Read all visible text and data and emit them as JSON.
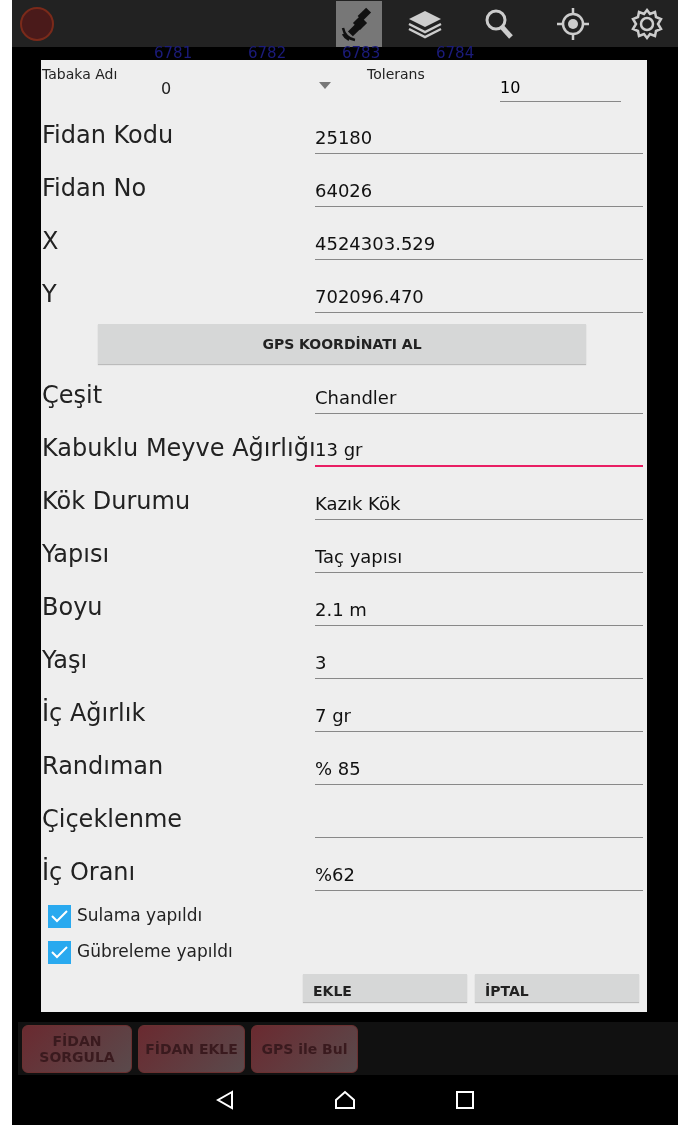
{
  "toolbar": {
    "icons": [
      {
        "kind": "satellite",
        "selected": true
      },
      {
        "kind": "layers",
        "selected": false
      },
      {
        "kind": "search",
        "selected": false
      },
      {
        "kind": "locate",
        "selected": false
      },
      {
        "kind": "settings",
        "selected": false
      }
    ]
  },
  "map_labels": [
    "6781",
    "6782",
    "6783",
    "6784"
  ],
  "dialog": {
    "top_row": {
      "layer_label": "Tabaka Adı",
      "layer_value": "0",
      "tolerance_label": "Tolerans",
      "tolerance_value": "10"
    },
    "fields": [
      {
        "label": "Fidan Kodu",
        "value": "25180",
        "focused": false
      },
      {
        "label": "Fidan No",
        "value": "64026",
        "focused": false
      },
      {
        "label": "X",
        "value": "4524303.529",
        "focused": false
      },
      {
        "label": "Y",
        "value": "702096.470",
        "focused": false
      },
      {
        "kind": "button",
        "label": "GPS KOORDİNATI AL"
      },
      {
        "label": "Çeşit",
        "value": "Chandler",
        "focused": false
      },
      {
        "label": "Kabuklu Meyve Ağırlığı",
        "value": "13 gr",
        "focused": true
      },
      {
        "label": "Kök Durumu",
        "value": "Kazık Kök",
        "focused": false
      },
      {
        "label": "Yapısı",
        "value": "Taç yapısı",
        "focused": false
      },
      {
        "label": "Boyu",
        "value": "2.1 m",
        "focused": false
      },
      {
        "label": "Yaşı",
        "value": "3",
        "focused": false
      },
      {
        "label": "İç Ağırlık",
        "value": "7 gr",
        "focused": false
      },
      {
        "label": "Randıman",
        "value": "% 85",
        "focused": false
      },
      {
        "label": "Çiçeklenme",
        "focused": false
      },
      {
        "label": "İç Oranı",
        "value": "%62",
        "focused": false
      }
    ],
    "checkboxes": [
      {
        "label": "Sulama yapıldı",
        "checked": true
      },
      {
        "label": "Gübreleme yapıldı",
        "checked": true
      }
    ],
    "buttons": [
      "EKLE",
      "İPTAL"
    ]
  },
  "bottom_buttons": [
    "FİDAN SORGULA",
    "FİDAN EKLE",
    "GPS ile Bul"
  ]
}
